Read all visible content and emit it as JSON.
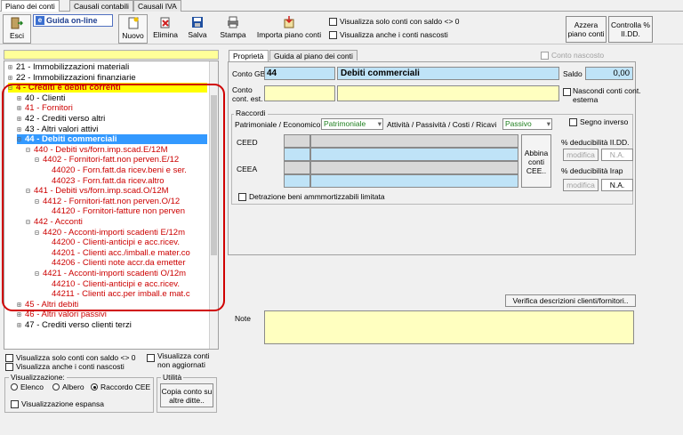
{
  "tabs": [
    "Piano dei conti",
    "Causali contabili",
    "Causali IVA"
  ],
  "toolbar": {
    "esci": "Esci",
    "guida": "Guida on-line",
    "nuovo": "Nuovo",
    "elimina": "Elimina",
    "salva": "Salva",
    "stampa": "Stampa",
    "importa": "Importa piano conti",
    "opt_saldo": "Visualizza solo conti con saldo <> 0",
    "opt_nascosti": "Visualizza anche i conti nascosti",
    "azzera": [
      "Azzera",
      "piano conti"
    ],
    "controlla": [
      "Controlla %",
      "II.DD."
    ]
  },
  "tree": [
    {
      "toggle": "⊞",
      "text": "21 - Immobilizzazioni materiali",
      "style": "normal"
    },
    {
      "toggle": "⊞",
      "text": "22 - Immobilizzazioni finanziarie",
      "style": "normal"
    },
    {
      "toggle": "⊟",
      "text": "4 - Crediti e debiti correnti",
      "style": "yellow"
    },
    {
      "toggle": "⊞",
      "text": "40 - Clienti",
      "style": "normal"
    },
    {
      "toggle": "⊞",
      "text": "41 - Fornitori",
      "style": "red"
    },
    {
      "toggle": "⊞",
      "text": "42 - Crediti verso altri",
      "style": "normal"
    },
    {
      "toggle": "⊞",
      "text": "43 - Altri valori attivi",
      "style": "normal"
    },
    {
      "toggle": "⊟",
      "text": "44 - Debiti commerciali",
      "style": "selected"
    },
    {
      "toggle": "⊟",
      "text": "440 - Debiti vs/forn.imp.scad.E/12M",
      "style": "red"
    },
    {
      "toggle": "⊟",
      "text": "4402 - Fornitori-fatt.non perven.E/12",
      "style": "red"
    },
    {
      "toggle": "",
      "text": "44020 - Forn.fatt.da ricev.beni e ser.",
      "style": "red"
    },
    {
      "toggle": "",
      "text": "44023 - Forn.fatt.da ricev.altro",
      "style": "red"
    },
    {
      "toggle": "⊟",
      "text": "441 - Debiti vs/forn.imp.scad.O/12M",
      "style": "red"
    },
    {
      "toggle": "⊟",
      "text": "4412 - Fornitori-fatt.non perven.O/12",
      "style": "red"
    },
    {
      "toggle": "",
      "text": "44120 - Fornitori-fatture non perven",
      "style": "red"
    },
    {
      "toggle": "⊟",
      "text": "442 - Acconti",
      "style": "red"
    },
    {
      "toggle": "⊟",
      "text": "4420 - Acconti-importi scadenti E/12m",
      "style": "red"
    },
    {
      "toggle": "",
      "text": "44200 - Clienti-anticipi e acc.ricev.",
      "style": "red"
    },
    {
      "toggle": "",
      "text": "44201 - Clienti acc./imball.e mater.co",
      "style": "red"
    },
    {
      "toggle": "",
      "text": "44206 - Clienti note accr.da emetter",
      "style": "red"
    },
    {
      "toggle": "⊟",
      "text": "4421 - Acconti-importi scadenti O/12m",
      "style": "red"
    },
    {
      "toggle": "",
      "text": "44210 - Clienti-anticipi e acc.ricev.",
      "style": "red"
    },
    {
      "toggle": "",
      "text": "44211 - Clienti acc.per imball.e mat.c",
      "style": "red"
    },
    {
      "toggle": "⊞",
      "text": "45 - Altri debiti",
      "style": "red"
    },
    {
      "toggle": "⊞",
      "text": "46 - Altri valori passivi",
      "style": "red"
    },
    {
      "toggle": "⊞",
      "text": "47 - Crediti verso clienti terzi",
      "style": "normal"
    }
  ],
  "bottom_left": {
    "opt_saldo": "Visualizza solo conti con saldo <> 0",
    "opt_nascosti": "Visualizza anche i conti nascosti",
    "opt_non_agg": [
      "Visualizza conti",
      "non aggiornati"
    ],
    "visualizzazione": "Visualizzazione:",
    "radio_elenco": "Elenco",
    "radio_albero": "Albero",
    "radio_raccordo": "Raccordo CEE",
    "opt_espansa": "Visualizzazione espansa",
    "utilita": "Utilità",
    "copia": [
      "Copia conto su",
      "altre ditte.."
    ]
  },
  "right": {
    "tab_proprieta": "Proprietà",
    "tab_guida": "Guida al piano dei conti",
    "conto_nascosto": "Conto nascosto",
    "conto_gb_label": "Conto GB",
    "conto_gb_code": "44",
    "conto_gb_desc": "Debiti commerciali",
    "saldo_label": "Saldo",
    "saldo_value": "0,00",
    "conto_est_label": [
      "Conto",
      "cont. est."
    ],
    "nascondi": [
      "Nascondi conti cont.",
      "esterna"
    ],
    "raccordi": "Raccordi",
    "pat_eco_label": "Patrimoniale / Economico",
    "pat_eco_value": "Patrimoniale",
    "att_pas_label": "Attività / Passività / Costi / Ricavi",
    "att_pas_value": "Passivo",
    "segno_inverso": "Segno inverso",
    "ceed": "CEED",
    "ceea": "CEEA",
    "abbina": [
      "Abbina",
      "conti",
      "CEE.."
    ],
    "ded_iidd": "% deducibilità II.DD.",
    "ded_irap": "% deducibilità Irap",
    "modifica": "modifica",
    "na": "N.A.",
    "detrazione": "Detrazione beni ammmortizzabili limitata",
    "verifica": "Verifica descrizioni clienti/fornitori..",
    "note_label": "Note"
  },
  "colors": {
    "selected": "#3399ff",
    "highlight": "#ffff00",
    "red_text": "#cc0000",
    "annotation": "#d00000"
  }
}
